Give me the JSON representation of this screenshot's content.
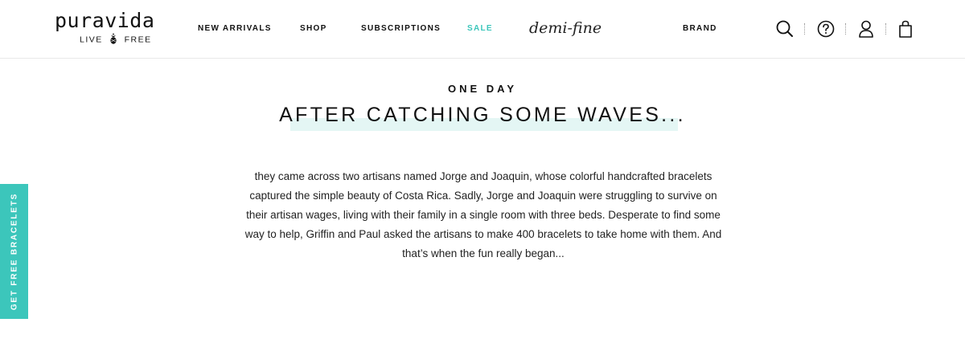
{
  "header": {
    "logo": {
      "wordmark": "puravida",
      "tagline_left": "LIVE",
      "tagline_right": "FREE"
    },
    "nav": [
      {
        "label": "NEW ARRIVALS"
      },
      {
        "label": "SHOP"
      },
      {
        "label": "SUBSCRIPTIONS"
      },
      {
        "label": "SALE"
      }
    ],
    "brand_script": "demi-fine",
    "brand_label": "BRAND",
    "icons": [
      "search-icon",
      "help-icon",
      "account-icon",
      "bag-icon"
    ]
  },
  "main": {
    "eyebrow": "ONE DAY",
    "headline": "AFTER CATCHING SOME WAVES...",
    "body": "they came across two artisans named Jorge and Joaquin, whose colorful handcrafted bracelets captured the simple beauty of Costa Rica. Sadly, Jorge and Joaquin were struggling to survive on their artisan wages, living with their family in a single room with three beds. Desperate to find some way to help, Griffin and Paul asked the artisans to make 400 bracelets to take home with them. And that’s when the fun really began..."
  },
  "side_tab": {
    "label": "GET FREE BRACELETS"
  },
  "colors": {
    "accent": "#3cc6bb",
    "highlight": "#e4f6f4",
    "text": "#111111"
  }
}
